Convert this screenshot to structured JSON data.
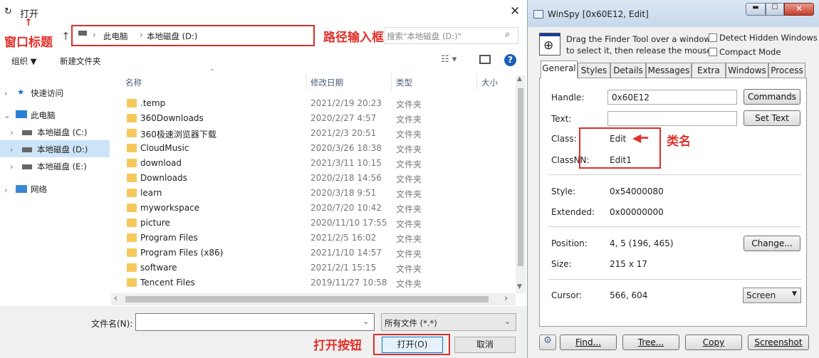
{
  "dialog": {
    "title": "打开",
    "annotation_title": "窗口标题",
    "annotation_path": "路径输入框",
    "annotation_open": "打开按钮",
    "breadcrumb": [
      "此电脑",
      "本地磁盘 (D:)"
    ],
    "search_placeholder": "搜索\"本地磁盘 (D:)\"",
    "toolbar": {
      "organize": "组织 ▼",
      "new_folder": "新建文件夹"
    },
    "columns": {
      "name": "名称",
      "date": "修改日期",
      "type": "类型",
      "size": "大小"
    },
    "tree": {
      "quick_access": "快速访问",
      "this_pc": "此电脑",
      "drive_c": "本地磁盘 (C:)",
      "drive_d": "本地磁盘 (D:)",
      "drive_e": "本地磁盘 (E:)",
      "network": "网络"
    },
    "files": [
      {
        "name": ".temp",
        "date": "2021/2/19 20:23",
        "type": "文件夹"
      },
      {
        "name": "360Downloads",
        "date": "2020/2/27 4:57",
        "type": "文件夹"
      },
      {
        "name": "360极速浏览器下载",
        "date": "2021/2/3 20:51",
        "type": "文件夹"
      },
      {
        "name": "CloudMusic",
        "date": "2020/3/26 18:38",
        "type": "文件夹"
      },
      {
        "name": "download",
        "date": "2021/3/11 10:15",
        "type": "文件夹"
      },
      {
        "name": "Downloads",
        "date": "2020/2/18 14:56",
        "type": "文件夹"
      },
      {
        "name": "learn",
        "date": "2020/3/18 9:51",
        "type": "文件夹"
      },
      {
        "name": "myworkspace",
        "date": "2020/7/20 10:42",
        "type": "文件夹"
      },
      {
        "name": "picture",
        "date": "2020/11/10 17:55",
        "type": "文件夹"
      },
      {
        "name": "Program Files",
        "date": "2021/2/5 16:02",
        "type": "文件夹"
      },
      {
        "name": "Program Files (x86)",
        "date": "2021/1/10 14:57",
        "type": "文件夹"
      },
      {
        "name": "software",
        "date": "2021/2/1 15:15",
        "type": "文件夹"
      },
      {
        "name": "Tencent Files",
        "date": "2019/11/27 10:58",
        "type": "文件夹"
      }
    ],
    "filename_label": "文件名(N):",
    "filter": "所有文件 (*.*)",
    "open_button": "打开(O)",
    "cancel_button": "取消"
  },
  "winspy": {
    "title": "WinSpy [0x60E12, Edit]",
    "finder_text_1": "Drag the Finder Tool over a window",
    "finder_text_2": "to select it, then release the mouse",
    "detect_hidden": "Detect Hidden Windows",
    "compact_mode": "Compact Mode",
    "tabs": [
      "General",
      "Styles",
      "Details",
      "Messages",
      "Extra",
      "Windows",
      "Process"
    ],
    "handle_label": "Handle:",
    "handle_value": "0x60E12",
    "commands_button": "Commands",
    "text_label": "Text:",
    "text_value": "",
    "set_text_button": "Set Text",
    "class_label": "Class:",
    "class_value": "Edit",
    "classnn_label": "ClassNN:",
    "classnn_value": "Edit1",
    "annotation_class": "类名",
    "style_label": "Style:",
    "style_value": "0x54000080",
    "extended_label": "Extended:",
    "extended_value": "0x00000000",
    "position_label": "Position:",
    "position_value": "4, 5 (196, 465)",
    "change_button": "Change...",
    "size_label": "Size:",
    "size_value": "215 x 17",
    "cursor_label": "Cursor:",
    "cursor_value": "566, 604",
    "screen_select": "Screen",
    "find_button": "Find...",
    "tree_button": "Tree...",
    "copy_button": "Copy",
    "screenshot_button": "Screenshot"
  }
}
